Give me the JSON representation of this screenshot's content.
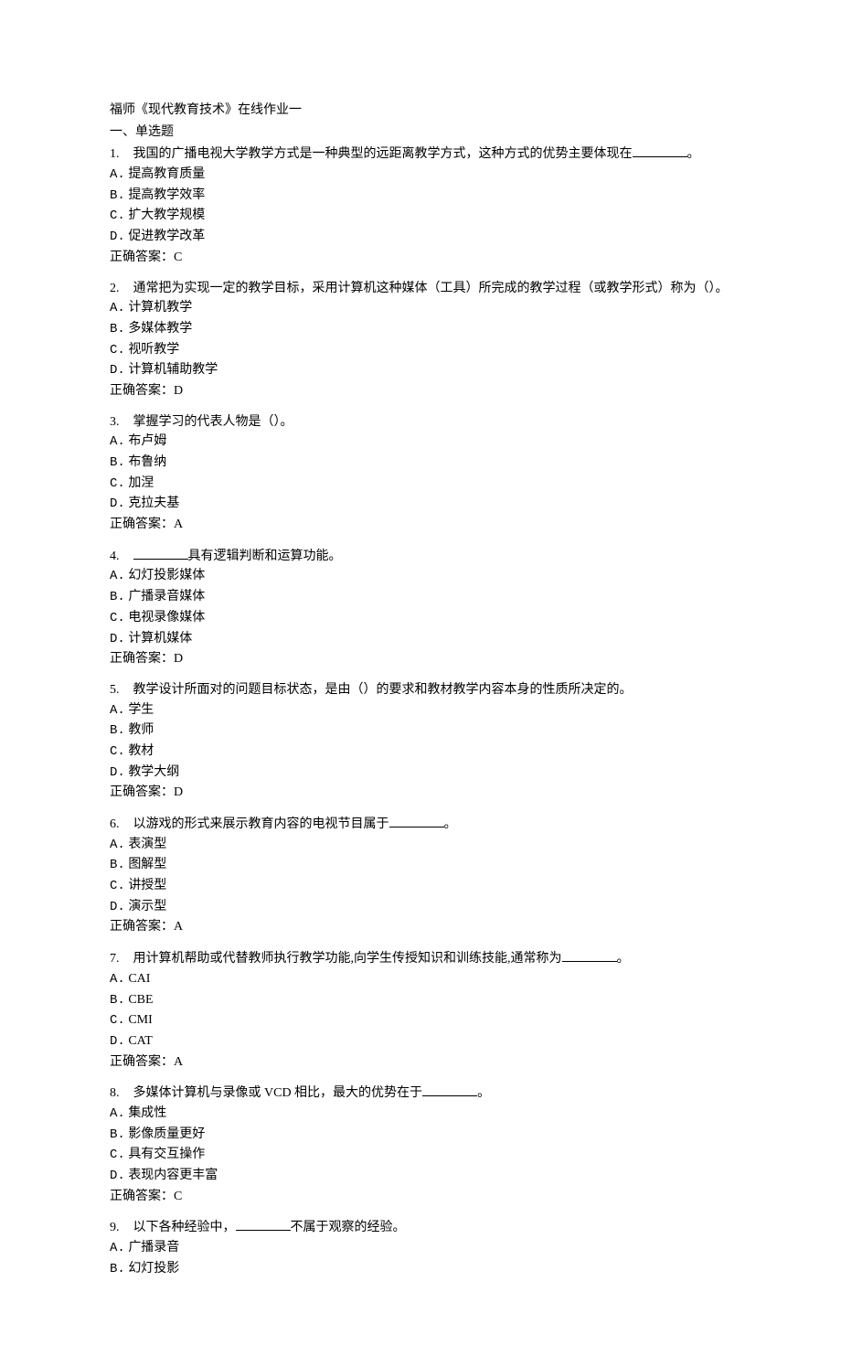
{
  "title": "福师《现代教育技术》在线作业一",
  "section_header": "一、单选题",
  "answer_label_prefix": "正确答案：",
  "questions": [
    {
      "num": "1.",
      "stem_pre": "我国的广播电视大学教学方式是一种典型的远距离教学方式，这种方式的优势主要体现在",
      "stem_post": "。",
      "has_blank": true,
      "options": [
        {
          "label": "A.",
          "text": "提高教育质量"
        },
        {
          "label": "B.",
          "text": "提高教学效率"
        },
        {
          "label": "C.",
          "text": "扩大教学规模"
        },
        {
          "label": "D.",
          "text": "促进教学改革"
        }
      ],
      "answer": "C"
    },
    {
      "num": "2.",
      "stem_pre": "通常把为实现一定的教学目标，采用计算机这种媒体（工具）所完成的教学过程（或教学形式）称为（）。",
      "stem_post": "",
      "has_blank": false,
      "options": [
        {
          "label": "A.",
          "text": "计算机教学"
        },
        {
          "label": "B.",
          "text": "多媒体教学"
        },
        {
          "label": "C.",
          "text": "视听教学"
        },
        {
          "label": "D.",
          "text": "计算机辅助教学"
        }
      ],
      "answer": "D"
    },
    {
      "num": "3.",
      "stem_pre": "掌握学习的代表人物是（）。",
      "stem_post": "",
      "has_blank": false,
      "options": [
        {
          "label": "A.",
          "text": "布卢姆"
        },
        {
          "label": "B.",
          "text": "布鲁纳"
        },
        {
          "label": "C.",
          "text": "加涅"
        },
        {
          "label": "D.",
          "text": "克拉夫基"
        }
      ],
      "answer": "A"
    },
    {
      "num": "4.",
      "stem_pre": "",
      "stem_post": "具有逻辑判断和运算功能。",
      "has_blank": true,
      "options": [
        {
          "label": "A.",
          "text": "幻灯投影媒体"
        },
        {
          "label": "B.",
          "text": "广播录音媒体"
        },
        {
          "label": "C.",
          "text": "电视录像媒体"
        },
        {
          "label": "D.",
          "text": "计算机媒体"
        }
      ],
      "answer": "D"
    },
    {
      "num": "5.",
      "stem_pre": "教学设计所面对的问题目标状态，是由（）的要求和教材教学内容本身的性质所决定的。",
      "stem_post": "",
      "has_blank": false,
      "options": [
        {
          "label": "A.",
          "text": "学生"
        },
        {
          "label": "B.",
          "text": "教师"
        },
        {
          "label": "C.",
          "text": "教材"
        },
        {
          "label": "D.",
          "text": "教学大纲"
        }
      ],
      "answer": "D"
    },
    {
      "num": "6.",
      "stem_pre": "以游戏的形式来展示教育内容的电视节目属于",
      "stem_post": "。",
      "has_blank": true,
      "options": [
        {
          "label": "A.",
          "text": "表演型"
        },
        {
          "label": "B.",
          "text": "图解型"
        },
        {
          "label": "C.",
          "text": "讲授型"
        },
        {
          "label": "D.",
          "text": "演示型"
        }
      ],
      "answer": "A"
    },
    {
      "num": "7.",
      "stem_pre": "用计算机帮助或代替教师执行教学功能,向学生传授知识和训练技能,通常称为",
      "stem_post": "。",
      "has_blank": true,
      "options": [
        {
          "label": "A.",
          "text": "CAI"
        },
        {
          "label": "B.",
          "text": "CBE"
        },
        {
          "label": "C.",
          "text": "CMI"
        },
        {
          "label": "D.",
          "text": "CAT"
        }
      ],
      "answer": "A"
    },
    {
      "num": "8.",
      "stem_pre": "多媒体计算机与录像或 VCD 相比，最大的优势在于",
      "stem_post": "。",
      "has_blank": true,
      "options": [
        {
          "label": "A.",
          "text": "集成性"
        },
        {
          "label": "B.",
          "text": "影像质量更好"
        },
        {
          "label": "C.",
          "text": "具有交互操作"
        },
        {
          "label": "D.",
          "text": "表现内容更丰富"
        }
      ],
      "answer": "C"
    },
    {
      "num": "9.",
      "stem_pre": "以下各种经验中，",
      "stem_post": "不属于观察的经验。",
      "has_blank": true,
      "options": [
        {
          "label": "A.",
          "text": "广播录音"
        },
        {
          "label": "B.",
          "text": "幻灯投影"
        }
      ],
      "answer": null
    }
  ]
}
